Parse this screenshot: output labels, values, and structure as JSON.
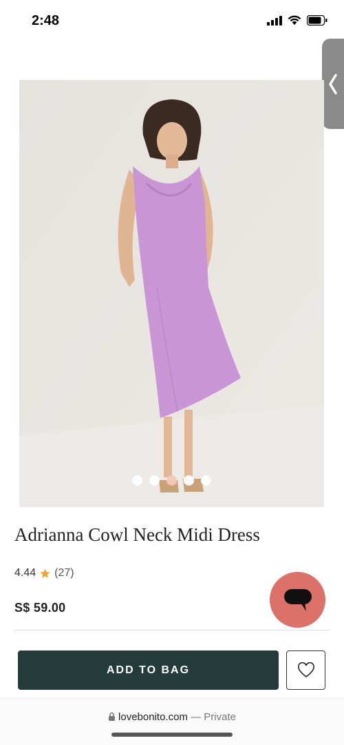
{
  "status_bar": {
    "time": "2:48",
    "icons": [
      "signal-icon",
      "wifi-icon",
      "battery-icon"
    ]
  },
  "side_tab": {
    "icon": "chevron-left-icon"
  },
  "product": {
    "image_dots_count": 5,
    "active_dot_index": 2,
    "title": "Adrianna Cowl Neck Midi Dress",
    "rating": "4.44",
    "rating_count": "(27)",
    "price": "S$ 59.00",
    "dress_color": "#c995d4"
  },
  "chat": {
    "icon": "chat-bubble-icon",
    "color": "#dc716a"
  },
  "actions": {
    "add_to_bag_label": "ADD TO BAG",
    "wishlist_icon": "heart-icon",
    "button_color": "#233b3a"
  },
  "browser": {
    "domain": "lovebonito.com",
    "separator": "—",
    "mode": "Private"
  }
}
